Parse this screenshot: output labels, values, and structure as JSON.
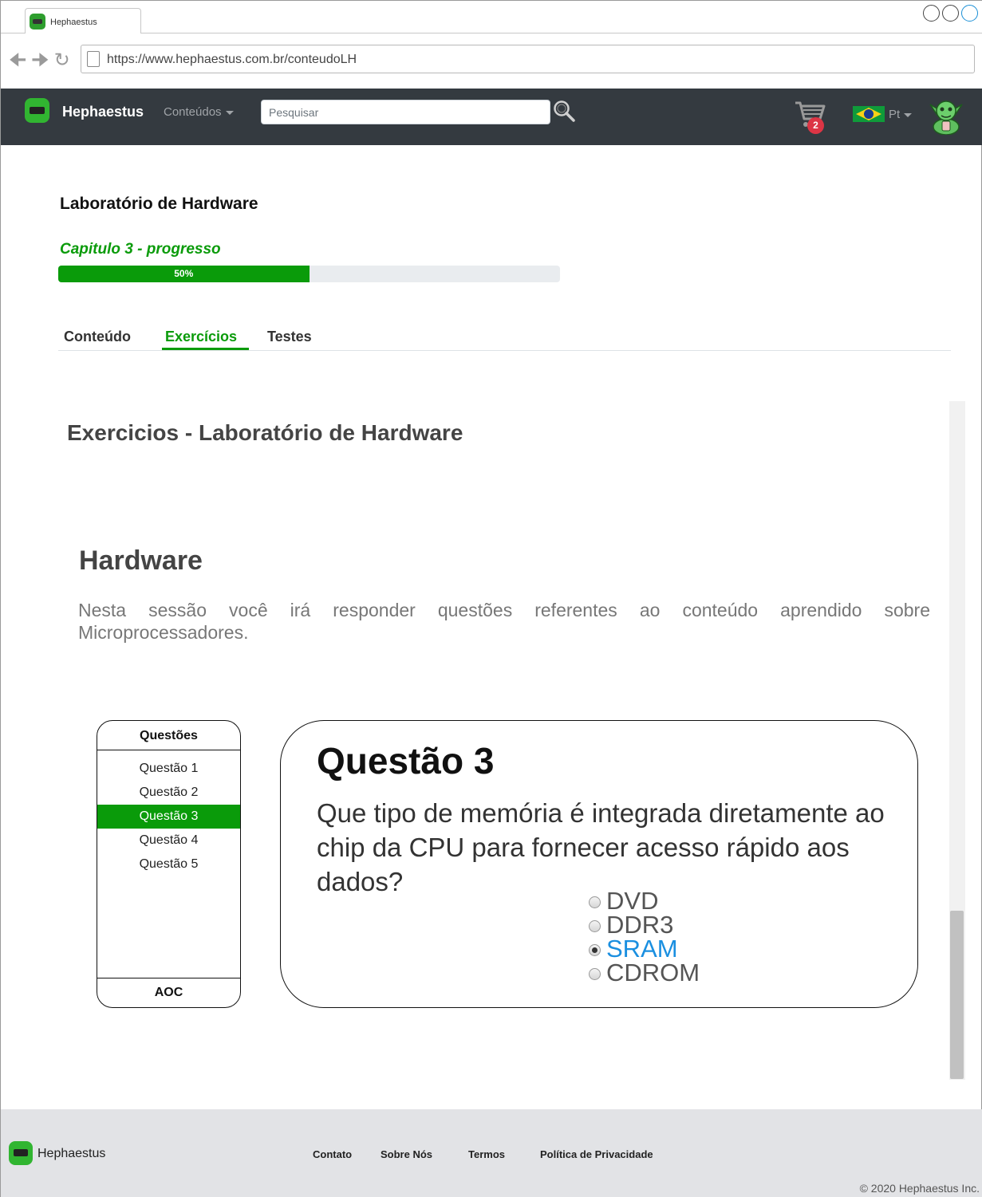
{
  "browser": {
    "tab_title": "Hephaestus",
    "url": "https://www.hephaestus.com.br/conteudoLH"
  },
  "navbar": {
    "brand": "Hephaestus",
    "menu_conteudos": "Conteúdos",
    "search_placeholder": "Pesquisar",
    "cart_count": "2",
    "language": "Pt"
  },
  "course": {
    "title": "Laboratório de Hardware",
    "progress_label": "Capitulo 3 - progresso",
    "progress_text": "50%",
    "progress_value": 0.5
  },
  "tabs": [
    {
      "label": "Conteúdo",
      "active": false
    },
    {
      "label": "Exercícios",
      "active": true
    },
    {
      "label": "Testes",
      "active": false
    }
  ],
  "content": {
    "section_title": "Exercicios - Laboratório de Hardware",
    "hw_title": "Hardware",
    "hw_description": "Nesta sessão você irá responder questões referentes ao conteúdo aprendido sobre Microprocessadores."
  },
  "questions_panel": {
    "header": "Questões",
    "items": [
      "Questão 1",
      "Questão 2",
      "Questão 3",
      "Questão 4",
      "Questão 5"
    ],
    "active_index": 2,
    "footer": "AOC"
  },
  "question": {
    "title": "Questão 3",
    "text": "Que tipo de memória é integrada diretamente ao chip da CPU para fornecer acesso rápido aos dados?",
    "options": [
      "DVD",
      "DDR3",
      "SRAM",
      "CDROM"
    ],
    "selected_index": 2
  },
  "footer": {
    "brand": "Hephaestus",
    "links": [
      "Contato",
      "Sobre Nós",
      "Termos",
      "Política de Privacidade"
    ],
    "copyright": "© 2020 Hephaestus Inc."
  },
  "colors": {
    "accent_green": "#0a9b0a",
    "navbar_bg": "#343a40",
    "selected_option": "#1a8fe0",
    "badge_red": "#dc3545"
  }
}
